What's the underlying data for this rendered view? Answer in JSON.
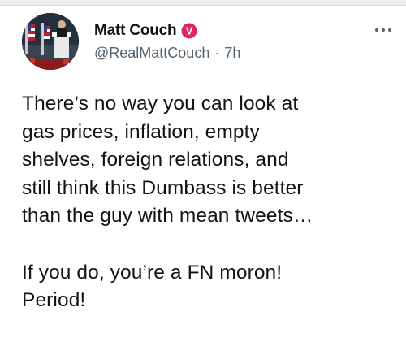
{
  "author": {
    "display_name": "Matt Couch",
    "handle": "@RealMattCouch",
    "separator": "·",
    "time": "7h",
    "verified_badge_icon": "v-badge-icon",
    "badge_letter": "V",
    "badge_color": "#e0245e"
  },
  "tweet": {
    "lines": [
      "There’s no way you can look at",
      "gas prices, inflation, empty",
      "shelves, foreign relations, and",
      "still think this Dumbass is better",
      "than the guy with mean tweets…"
    ],
    "lines2": [
      "If you do, you’re a FN moron!",
      "Period!"
    ]
  },
  "menu": {
    "more_icon": "more-horizontal-icon"
  }
}
